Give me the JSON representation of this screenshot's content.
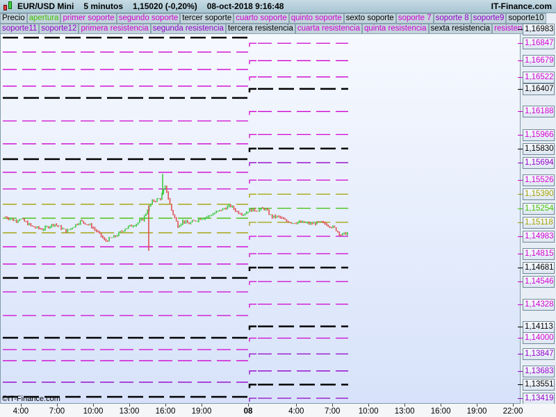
{
  "header": {
    "symbol": "EUR/USD Mini",
    "interval": "5 minutos",
    "price_change": "1,15020 (-0,20%)",
    "datetime": "08-oct-2018 9:16:48",
    "site": "IT-Finance.com",
    "icon": "candlestick-icon"
  },
  "legend_row1": [
    {
      "label": "Precio",
      "color": "#000000"
    },
    {
      "label": "apertura",
      "color": "#3fc000"
    },
    {
      "label": "primer soporte",
      "color": "#d000d0"
    },
    {
      "label": "segundo soporte",
      "color": "#d000d0"
    },
    {
      "label": "tercer soporte",
      "color": "#000000"
    },
    {
      "label": "cuarto soporte",
      "color": "#d000d0"
    },
    {
      "label": "quinto soporte",
      "color": "#d000d0"
    },
    {
      "label": "sexto soporte",
      "color": "#000000"
    },
    {
      "label": "soporte 7",
      "color": "#d000d0"
    },
    {
      "label": "soporte 8",
      "color": "#9000c8"
    },
    {
      "label": "soporte9",
      "color": "#9000c8"
    },
    {
      "label": "soporte10",
      "color": "#000000"
    }
  ],
  "legend_row2": [
    {
      "label": "soporte11",
      "color": "#9000c8"
    },
    {
      "label": "soporte12",
      "color": "#9000c8"
    },
    {
      "label": "primera resistencia",
      "color": "#d000d0"
    },
    {
      "label": "segunda resistencia",
      "color": "#9000c8"
    },
    {
      "label": "tercera resistencia",
      "color": "#000000"
    },
    {
      "label": "cuarta resistencia",
      "color": "#d000d0"
    },
    {
      "label": "quinta resistencia",
      "color": "#d000d0"
    },
    {
      "label": "sexta resistencia",
      "color": "#000000"
    },
    {
      "label": "resistencia7",
      "color": "#d000d0"
    },
    {
      "label": "re",
      "color": "#d000d0"
    }
  ],
  "watermark": "©IT-Finance.com",
  "chart_data": {
    "type": "candlestick",
    "ylim": [
      1.1338,
      1.171
    ],
    "x_ticks": [
      {
        "label": "4:00",
        "hour": 4
      },
      {
        "label": "7:00",
        "hour": 7
      },
      {
        "label": "10:00",
        "hour": 10
      },
      {
        "label": "13:00",
        "hour": 13
      },
      {
        "label": "16:00",
        "hour": 16
      },
      {
        "label": "19:00",
        "hour": 19
      },
      {
        "label": "08",
        "hour": 24,
        "bold": true
      },
      {
        "label": "4:00",
        "hour": 28
      },
      {
        "label": "7:00",
        "hour": 31
      },
      {
        "label": "10:00",
        "hour": 34
      },
      {
        "label": "13:00",
        "hour": 37
      },
      {
        "label": "16:00",
        "hour": 40
      },
      {
        "label": "19:00",
        "hour": 43
      },
      {
        "label": "22:00",
        "hour": 46
      }
    ],
    "price_path": [
      [
        2.44,
        1.15171
      ],
      [
        3.42,
        1.15131
      ],
      [
        3.83,
        1.15157
      ],
      [
        4.87,
        1.15077
      ],
      [
        5.73,
        1.1505
      ],
      [
        6.71,
        1.15104
      ],
      [
        7.75,
        1.1503
      ],
      [
        8.9,
        1.15131
      ],
      [
        9.77,
        1.15084
      ],
      [
        10.64,
        1.14983
      ],
      [
        10.92,
        1.14936
      ],
      [
        11.79,
        1.14983
      ],
      [
        12.66,
        1.15064
      ],
      [
        13.52,
        1.15104
      ],
      [
        14.1,
        1.15151
      ],
      [
        14.5,
        1.15251
      ],
      [
        14.85,
        1.15319
      ],
      [
        15.54,
        1.15352
      ],
      [
        15.94,
        1.15466
      ],
      [
        16.4,
        1.15251
      ],
      [
        16.98,
        1.15084
      ],
      [
        17.39,
        1.15131
      ],
      [
        17.85,
        1.15104
      ],
      [
        18.71,
        1.15151
      ],
      [
        19.51,
        1.15171
      ],
      [
        20.59,
        1.15218
      ],
      [
        21.68,
        1.15265
      ],
      [
        22.04,
        1.15278
      ],
      [
        22.77,
        1.15218
      ],
      [
        23.49,
        1.15198
      ],
      [
        24.06,
        1.15238
      ],
      [
        24.75,
        1.15238
      ],
      [
        25.33,
        1.15251
      ],
      [
        25.9,
        1.15171
      ],
      [
        26.48,
        1.15171
      ],
      [
        27.06,
        1.15131
      ],
      [
        27.64,
        1.15117
      ],
      [
        28.5,
        1.15117
      ],
      [
        29.08,
        1.15104
      ],
      [
        29.94,
        1.15117
      ],
      [
        30.52,
        1.15097
      ],
      [
        31.1,
        1.15064
      ],
      [
        31.67,
        1.14996
      ],
      [
        32.25,
        1.15017
      ]
    ],
    "prev_day_levels": [
      {
        "price": 1.16902,
        "color": "#000000"
      },
      {
        "price": 1.16762,
        "color": "#d000d0"
      },
      {
        "price": 1.16594,
        "color": "#d000d0"
      },
      {
        "price": 1.16433,
        "color": "#d000d0"
      },
      {
        "price": 1.16319,
        "color": "#000000"
      },
      {
        "price": 1.16097,
        "color": "#d000d0"
      },
      {
        "price": 1.15876,
        "color": "#d000d0"
      },
      {
        "price": 1.15728,
        "color": "#000000"
      },
      {
        "price": 1.15601,
        "color": "#d000d0"
      },
      {
        "price": 1.1544,
        "color": "#d000d0"
      },
      {
        "price": 1.15292,
        "color": "#a0a000"
      },
      {
        "price": 1.15158,
        "color": "#3fc000"
      },
      {
        "price": 1.15017,
        "color": "#a0a000"
      },
      {
        "price": 1.14882,
        "color": "#d000d0"
      },
      {
        "price": 1.14715,
        "color": "#d000d0"
      },
      {
        "price": 1.14581,
        "color": "#000000"
      },
      {
        "price": 1.14446,
        "color": "#d000d0"
      },
      {
        "price": 1.14218,
        "color": "#d000d0"
      },
      {
        "price": 1.14003,
        "color": "#000000"
      },
      {
        "price": 1.13889,
        "color": "#d000d0"
      },
      {
        "price": 1.13782,
        "color": "#d000d0"
      },
      {
        "price": 1.13574,
        "color": "#9000c8"
      },
      {
        "price": 1.13433,
        "color": "#000000"
      }
    ],
    "levels": [
      {
        "label": "1,16847",
        "price": 1.16847,
        "color": "#d000d0"
      },
      {
        "label": "1,16679",
        "price": 1.16679,
        "color": "#d000d0"
      },
      {
        "label": "1,16522",
        "price": 1.16522,
        "color": "#d000d0"
      },
      {
        "label": "1,16407",
        "price": 1.16407,
        "color": "#000000"
      },
      {
        "label": "1,16188",
        "price": 1.16188,
        "color": "#d000d0"
      },
      {
        "label": "1,15966",
        "price": 1.15966,
        "color": "#d000d0"
      },
      {
        "label": "1,15830",
        "price": 1.1583,
        "color": "#000000"
      },
      {
        "label": "1,15694",
        "price": 1.15694,
        "color": "#9000c8"
      },
      {
        "label": "1,15526",
        "price": 1.15526,
        "color": "#d000d0"
      },
      {
        "label": "1,15390",
        "price": 1.1539,
        "color": "#a0a000"
      },
      {
        "label": "1,15254",
        "price": 1.15254,
        "color": "#3fc000"
      },
      {
        "label": "1,15118",
        "price": 1.15118,
        "color": "#a0a000"
      },
      {
        "label": "1,14983",
        "price": 1.14983,
        "color": "#d000d0"
      },
      {
        "label": "1,14815",
        "price": 1.14815,
        "color": "#d000d0"
      },
      {
        "label": "1,14681",
        "price": 1.14681,
        "color": "#000000"
      },
      {
        "label": "1,14546",
        "price": 1.14546,
        "color": "#d000d0"
      },
      {
        "label": "1,14328",
        "price": 1.14328,
        "color": "#d000d0"
      },
      {
        "label": "1,14113",
        "price": 1.14113,
        "color": "#000000"
      },
      {
        "label": "1,14000",
        "price": 1.14,
        "color": "#d000d0"
      },
      {
        "label": "1,13847",
        "price": 1.13847,
        "color": "#9000c8"
      },
      {
        "label": "1,13683",
        "price": 1.13683,
        "color": "#9000c8"
      },
      {
        "label": "1,13551",
        "price": 1.13551,
        "color": "#000000"
      },
      {
        "label": "1,13419",
        "price": 1.13419,
        "color": "#9000c8"
      }
    ],
    "top_tag": {
      "label": "1,16983",
      "price": 1.16983,
      "color": "#000000"
    }
  }
}
